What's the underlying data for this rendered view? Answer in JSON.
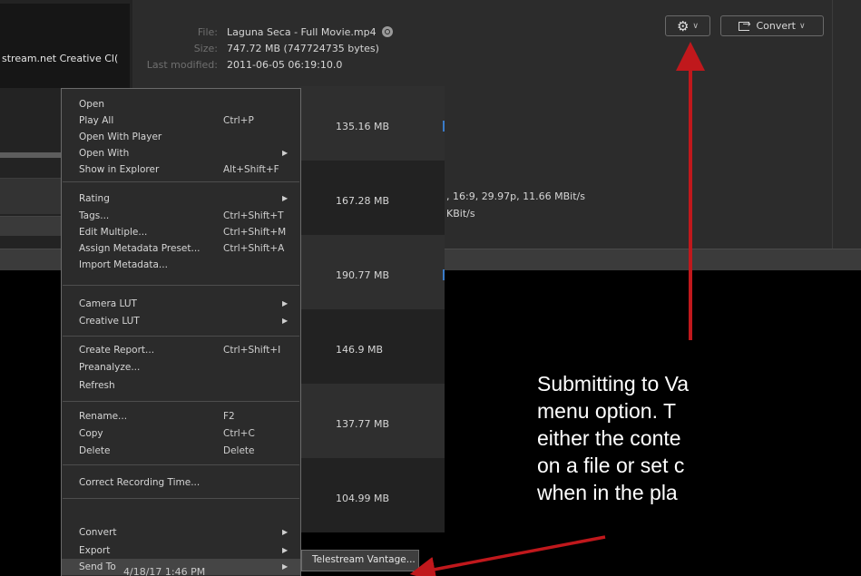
{
  "left_panel": {
    "title": "stream.net Creative Cl("
  },
  "file_info": {
    "file_label": "File:",
    "file_value": "Laguna Seca - Full Movie.mp4",
    "size_label": "Size:",
    "size_value": "747.72 MB (747724735 bytes)",
    "modified_label": "Last modified:",
    "modified_value": "2011-06-05 06:19:10.0",
    "zoom_icon": "magnifier-icon"
  },
  "toolbar": {
    "gear_icon": "gear-icon",
    "convert_label": "Convert",
    "chevron": "∨"
  },
  "clip_details": {
    "video_line": ", 16:9, 29.97p, 11.66 MBit/s",
    "audio_line": "KBit/s"
  },
  "file_list": {
    "sizes": [
      "135.16 MB",
      "167.28 MB",
      "190.77 MB",
      "146.9 MB",
      "137.77 MB",
      "104.99 MB"
    ]
  },
  "context_menu": {
    "items": [
      {
        "label": "Open",
        "shortcut": "",
        "submenu": false
      },
      {
        "label": "Play All",
        "shortcut": "Ctrl+P",
        "submenu": false
      },
      {
        "label": "Open With Player",
        "shortcut": "",
        "submenu": false
      },
      {
        "label": "Open With",
        "shortcut": "",
        "submenu": true
      },
      {
        "label": "Show in Explorer",
        "shortcut": "Alt+Shift+F",
        "submenu": false
      },
      {
        "label": "Rating",
        "shortcut": "",
        "submenu": true
      },
      {
        "label": "Tags...",
        "shortcut": "Ctrl+Shift+T",
        "submenu": false
      },
      {
        "label": "Edit Multiple...",
        "shortcut": "Ctrl+Shift+M",
        "submenu": false
      },
      {
        "label": "Assign Metadata Preset...",
        "shortcut": "Ctrl+Shift+A",
        "submenu": false
      },
      {
        "label": "Import Metadata...",
        "shortcut": "",
        "submenu": false
      },
      {
        "label": "Camera LUT",
        "shortcut": "",
        "submenu": true
      },
      {
        "label": "Creative LUT",
        "shortcut": "",
        "submenu": true
      },
      {
        "label": "Create Report...",
        "shortcut": "Ctrl+Shift+I",
        "submenu": false
      },
      {
        "label": "Preanalyze...",
        "shortcut": "",
        "submenu": false
      },
      {
        "label": "Refresh",
        "shortcut": "",
        "submenu": false
      },
      {
        "label": "Rename...",
        "shortcut": "F2",
        "submenu": false
      },
      {
        "label": "Copy",
        "shortcut": "Ctrl+C",
        "submenu": false
      },
      {
        "label": "Delete",
        "shortcut": "Delete",
        "submenu": false
      },
      {
        "label": "Correct Recording Time...",
        "shortcut": "",
        "submenu": false
      },
      {
        "label": "Convert",
        "shortcut": "",
        "submenu": true
      },
      {
        "label": "Export",
        "shortcut": "",
        "submenu": true
      },
      {
        "label": "Send To",
        "shortcut": "",
        "submenu": true,
        "highlighted": true
      }
    ],
    "date": "4/18/17 1:46 PM"
  },
  "submenu": {
    "label": "Telestream Vantage..."
  },
  "annotation": {
    "lines": [
      "Submitting to Va",
      "menu option.  T",
      "either the conte",
      "on a file or set c",
      "when in the pla"
    ],
    "arrow_color": "#c0181c"
  }
}
